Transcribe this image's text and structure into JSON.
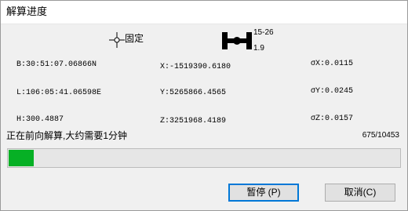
{
  "window": {
    "title": "解算进度"
  },
  "status": {
    "fix_label": "固定",
    "fix_icon": "crosshair-icon",
    "station_icon": "baseline-icon",
    "station_range": "15-26",
    "station_value": "1.9"
  },
  "coords": {
    "B": "B:30:51:07.06866N",
    "L": "L:106:05:41.06598E",
    "H": "H:300.4887",
    "X": "X:-1519390.6180",
    "Y": "Y:5265866.4565",
    "Z": "Z:3251968.4189",
    "sX": "σX:0.0115",
    "sY": "σY:0.0245",
    "sZ": "σZ:0.0157"
  },
  "progress": {
    "message": "正在前向解算,大约需要1分钟",
    "count": "675/10453",
    "fraction": 0.0646,
    "color": "#06b025"
  },
  "buttons": {
    "pause": "暂停 (P)",
    "cancel": "取消(C)"
  }
}
